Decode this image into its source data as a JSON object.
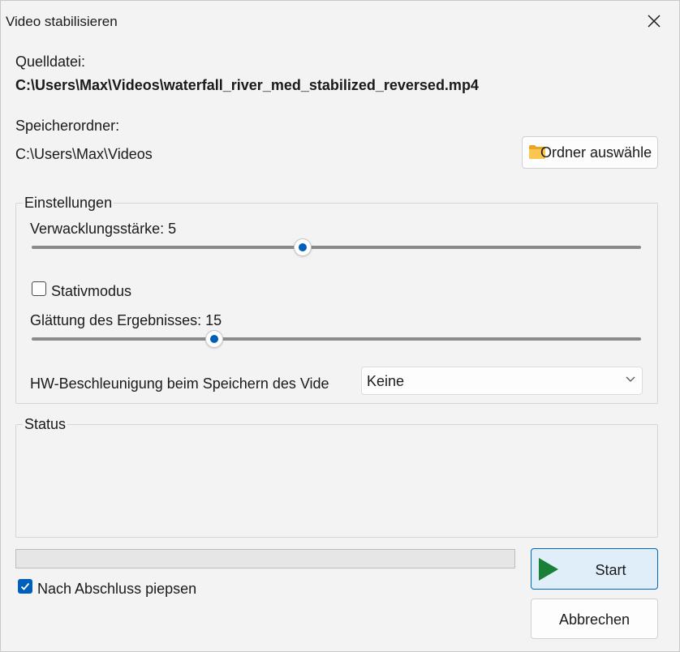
{
  "window": {
    "title": "Video stabilisieren"
  },
  "source": {
    "label": "Quelldatei:",
    "path": "C:\\Users\\Max\\Videos\\waterfall_river_med_stabilized_reversed.mp4"
  },
  "output": {
    "label": "Speicherordner:",
    "path": "C:\\Users\\Max\\Videos",
    "choose_button": "Ordner auswähle"
  },
  "settings": {
    "group_label": "Einstellungen",
    "shakiness": {
      "label": "Verwacklungsstärke: 5",
      "value": 5,
      "min": 1,
      "max": 10
    },
    "tripod": {
      "label": "Stativmodus",
      "checked": false
    },
    "smoothing": {
      "label": "Glättung des Ergebnisses: 15",
      "value": 15,
      "min": 0,
      "max": 50
    },
    "hw_accel": {
      "label": "HW-Beschleunigung beim Speichern des Vide",
      "selected": "Keine"
    }
  },
  "status": {
    "group_label": "Status",
    "text": ""
  },
  "progress": {
    "value": 0
  },
  "beep": {
    "label": "Nach Abschluss piepsen",
    "checked": true
  },
  "buttons": {
    "start": "Start",
    "cancel": "Abbrechen"
  },
  "colors": {
    "accent": "#005fb8",
    "start_icon": "#1a7f37"
  }
}
